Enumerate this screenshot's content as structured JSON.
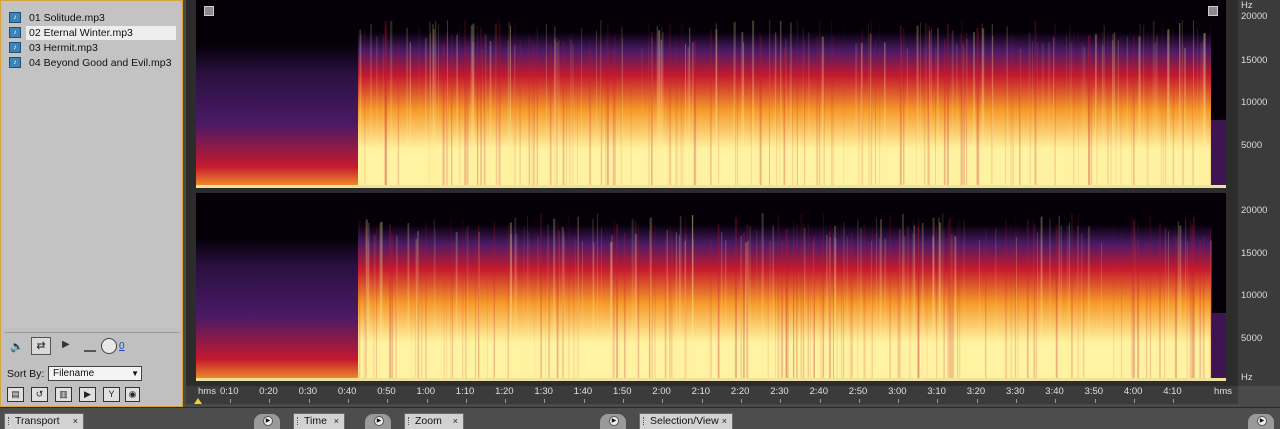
{
  "files": {
    "items": [
      {
        "label": "01 Solitude.mp3",
        "selected": false,
        "icon": "audio-file-icon"
      },
      {
        "label": "02 Eternal Winter.mp3",
        "selected": true,
        "icon": "audio-file-icon"
      },
      {
        "label": "03 Hermit.mp3",
        "selected": false,
        "icon": "audio-file-icon"
      },
      {
        "label": "04 Beyond Good and Evil.mp3",
        "selected": false,
        "icon": "audio-file-icon"
      }
    ],
    "volume_value": "0",
    "sort_by_label": "Sort By:",
    "sort_by_value": "Filename"
  },
  "spectral": {
    "freq_unit": "Hz",
    "freq_labels": [
      "20000",
      "15000",
      "10000",
      "5000"
    ],
    "time_unit_left": "hms",
    "time_unit_right": "hms",
    "time_labels": [
      "0:10",
      "0:20",
      "0:30",
      "0:40",
      "0:50",
      "1:00",
      "1:10",
      "1:20",
      "1:30",
      "1:40",
      "1:50",
      "2:00",
      "2:10",
      "2:20",
      "2:30",
      "2:40",
      "2:50",
      "3:00",
      "3:10",
      "3:20",
      "3:30",
      "3:40",
      "3:50",
      "4:00",
      "4:10"
    ],
    "colors": {
      "hot": "#fff2a0",
      "orange": "#f59a2a",
      "red": "#c41a2e",
      "purple": "#4b1a66",
      "black": "#050008",
      "timeline_marker": "#f0d020"
    }
  },
  "tabs": [
    {
      "label": "Transport"
    },
    {
      "label": "Time"
    },
    {
      "label": "Zoom"
    },
    {
      "label": "Selection/View"
    }
  ]
}
